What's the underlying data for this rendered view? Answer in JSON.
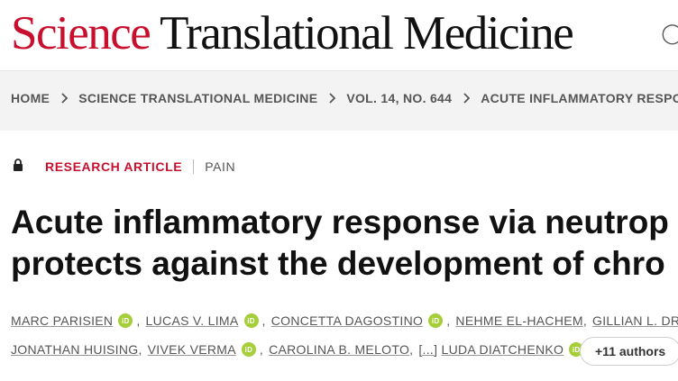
{
  "masthead": {
    "brand_science": "Science",
    "brand_rest": " Translational Medicine"
  },
  "breadcrumb": {
    "items": [
      "HOME",
      "SCIENCE TRANSLATIONAL MEDICINE",
      "VOL. 14, NO. 644",
      "ACUTE INFLAMMATORY RESPO"
    ]
  },
  "article": {
    "type": "RESEARCH ARTICLE",
    "subject": "PAIN",
    "title_line1": "Acute inflammatory response via neutrop",
    "title_line2": "protects against the development of chro",
    "authors_line1": [
      {
        "name": "MARC PARISIEN",
        "orcid": true
      },
      {
        "name": "LUCAS V. LIMA",
        "orcid": true
      },
      {
        "name": "CONCETTA DAGOSTINO",
        "orcid": true
      },
      {
        "name": "NEHME EL-HACHEM",
        "orcid": false
      },
      {
        "name": "GILLIAN L. DRURY",
        "orcid": false
      }
    ],
    "authors_line2": [
      {
        "name": "JONATHAN HUISING",
        "orcid": false
      },
      {
        "name": "VIVEK VERMA",
        "orcid": true
      },
      {
        "name": "CAROLINA B. MELOTO",
        "orcid": false
      },
      {
        "name": "[...]",
        "orcid": false
      },
      {
        "name": "LUDA DIATCHENKO",
        "orcid": true
      }
    ],
    "orcid_label": "iD",
    "more_authors": "+11 authors"
  },
  "colors": {
    "brand_red": "#c8102e",
    "orcid_green": "#a6ce39"
  }
}
